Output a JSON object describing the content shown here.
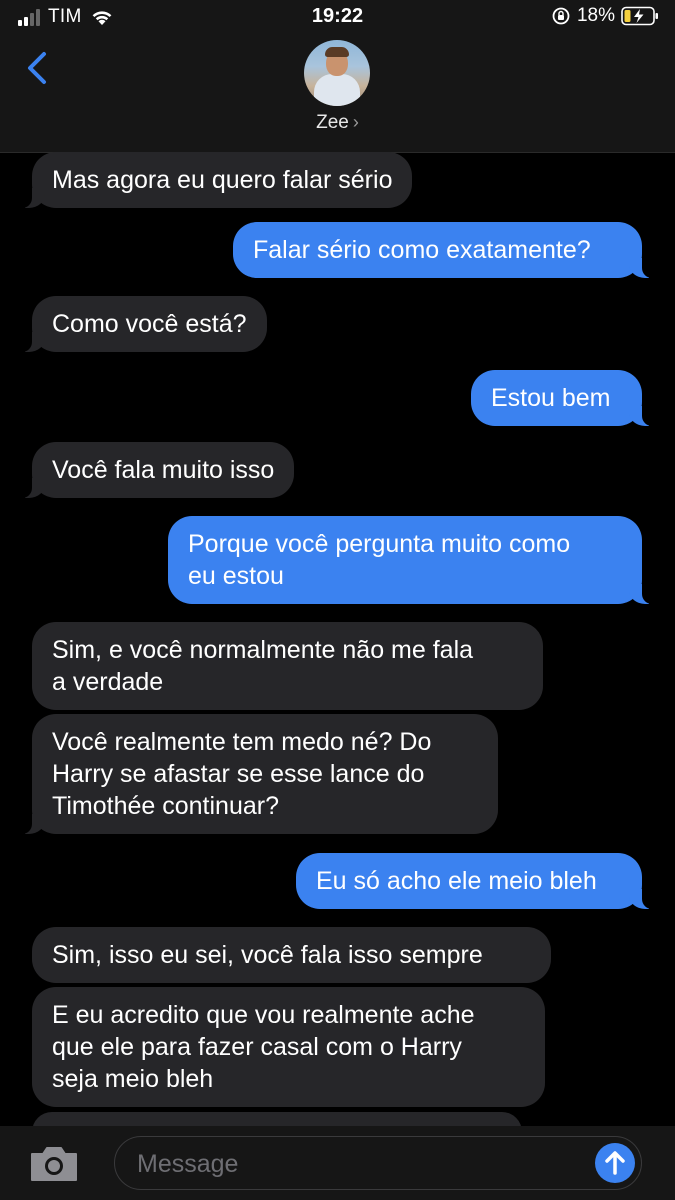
{
  "status_bar": {
    "carrier": "TIM",
    "time": "19:22",
    "battery_percent": "18%",
    "signal_bars": 2
  },
  "header": {
    "contact_name": "Zee",
    "chevron": "›"
  },
  "messages": [
    {
      "side": "received",
      "text": "Mas agora eu quero falar sério"
    },
    {
      "side": "sent",
      "text": "Falar sério como exatamente?"
    },
    {
      "side": "received",
      "text": "Como você está?"
    },
    {
      "side": "sent",
      "text": "Estou bem"
    },
    {
      "side": "received",
      "text": "Você fala muito isso"
    },
    {
      "side": "sent",
      "lines": [
        "Porque você pergunta muito como",
        "eu estou"
      ]
    },
    {
      "side": "received",
      "lines": [
        "Sim, e você normalmente não me fala",
        "a verdade"
      ]
    },
    {
      "side": "received",
      "lines": [
        "Você realmente tem medo né? Do",
        "Harry se afastar se esse lance do",
        "Timothée continuar?"
      ]
    },
    {
      "side": "sent",
      "text": "Eu só acho ele meio bleh"
    },
    {
      "side": "received",
      "text": "Sim, isso eu sei, você fala isso sempre"
    },
    {
      "side": "received",
      "lines": [
        "E eu acredito que vou realmente ache",
        "que ele para fazer casal com o Harry",
        "seja meio bleh"
      ]
    }
  ],
  "composer": {
    "placeholder": "Message"
  },
  "colors": {
    "sent_bubble": "#3b82f0",
    "received_bubble": "#262629",
    "accent": "#3b82f0"
  },
  "icons": [
    "back-chevron-icon",
    "camera-icon",
    "send-arrow-icon",
    "wifi-icon",
    "rotation-lock-icon",
    "battery-charging-icon"
  ]
}
